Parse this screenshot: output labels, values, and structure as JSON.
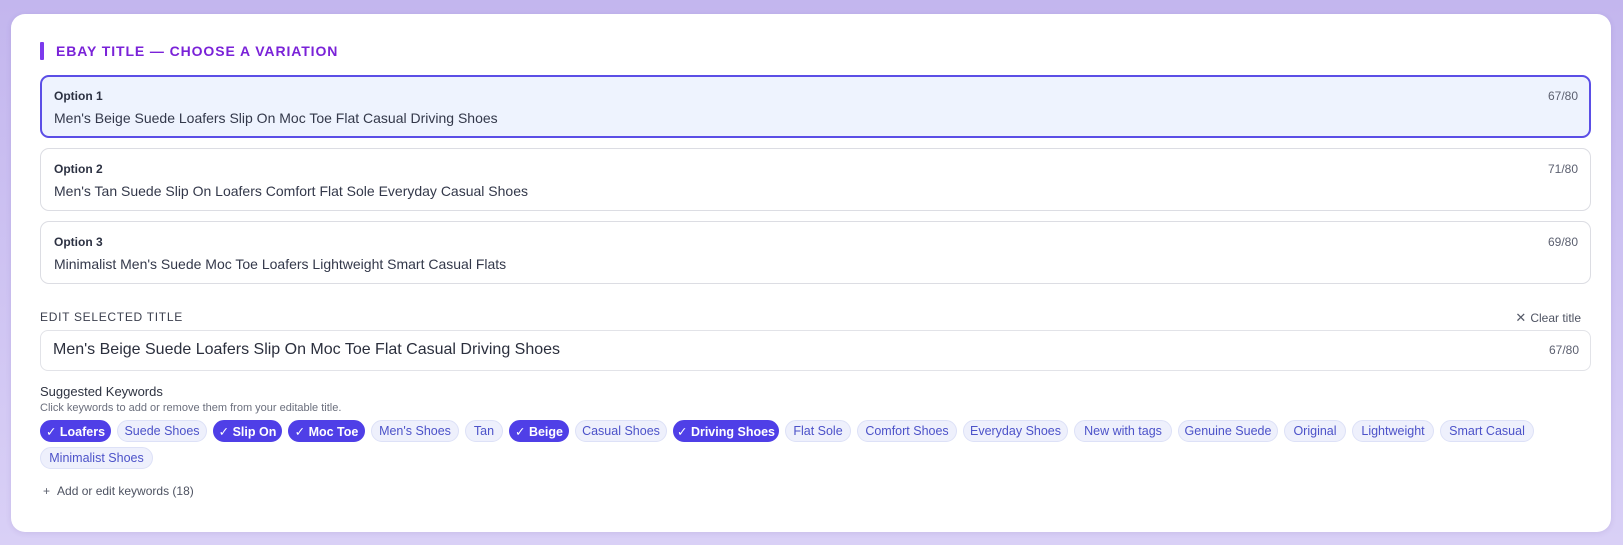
{
  "section": {
    "title": "EBAY TITLE — CHOOSE A VARIATION",
    "accent_color": "#7c3aed"
  },
  "options": [
    {
      "label": "Option 1",
      "count": "67/80",
      "text": "Men's Beige Suede Loafers Slip On Moc Toe Flat Casual Driving Shoes",
      "selected": true
    },
    {
      "label": "Option 2",
      "count": "71/80",
      "text": "Men's Tan Suede Slip On Loafers Comfort Flat Sole Everyday Casual Shoes",
      "selected": false
    },
    {
      "label": "Option 3",
      "count": "69/80",
      "text": "Minimalist Men's Suede Moc Toe Loafers Lightweight Smart Casual Flats",
      "selected": false
    }
  ],
  "editor": {
    "label": "EDIT SELECTED TITLE",
    "clear_label": "Clear title",
    "value": "Men's Beige Suede Loafers Slip On Moc Toe Flat Casual Driving Shoes",
    "count": "67/80"
  },
  "keywords": {
    "heading": "Suggested Keywords",
    "help": "Click keywords to add or remove them from your editable title.",
    "row1": [
      {
        "label": "✓ Loafers",
        "selected": true,
        "w": 71
      },
      {
        "label": "Suede Shoes",
        "selected": false,
        "w": 90
      },
      {
        "label": "✓ Slip On",
        "selected": true,
        "w": 69
      },
      {
        "label": "✓ Moc Toe",
        "selected": true,
        "w": 77
      },
      {
        "label": "Men's Shoes",
        "selected": false,
        "w": 88
      },
      {
        "label": "Tan",
        "selected": false,
        "w": 38
      },
      {
        "label": "✓ Beige",
        "selected": true,
        "w": 60
      },
      {
        "label": "Casual Shoes",
        "selected": false,
        "w": 92
      },
      {
        "label": "✓ Driving Shoes",
        "selected": true,
        "w": 106
      },
      {
        "label": "Flat Sole",
        "selected": false,
        "w": 66
      },
      {
        "label": "Comfort Shoes",
        "selected": false,
        "w": 100
      },
      {
        "label": "Everyday Shoes",
        "selected": false,
        "w": 105
      },
      {
        "label": "New with tags",
        "selected": false,
        "w": 98
      },
      {
        "label": "Genuine Suede",
        "selected": false,
        "w": 100
      },
      {
        "label": "Original",
        "selected": false,
        "w": 62
      },
      {
        "label": "Lightweight",
        "selected": false,
        "w": 82
      },
      {
        "label": "Smart Casual",
        "selected": false,
        "w": 94
      }
    ],
    "row2": [
      {
        "label": "Minimalist Shoes",
        "selected": false,
        "w": 113
      }
    ],
    "add_label": "Add or edit keywords (18)"
  },
  "colors": {
    "selected_border": "#5b4ee6",
    "selected_bg": "#eef3fe",
    "chip_on": "#4f3fe7",
    "chip_off_bg": "#eef0fc",
    "chip_off_text": "#4c52c9",
    "page_bg": "#c3b6ee"
  }
}
